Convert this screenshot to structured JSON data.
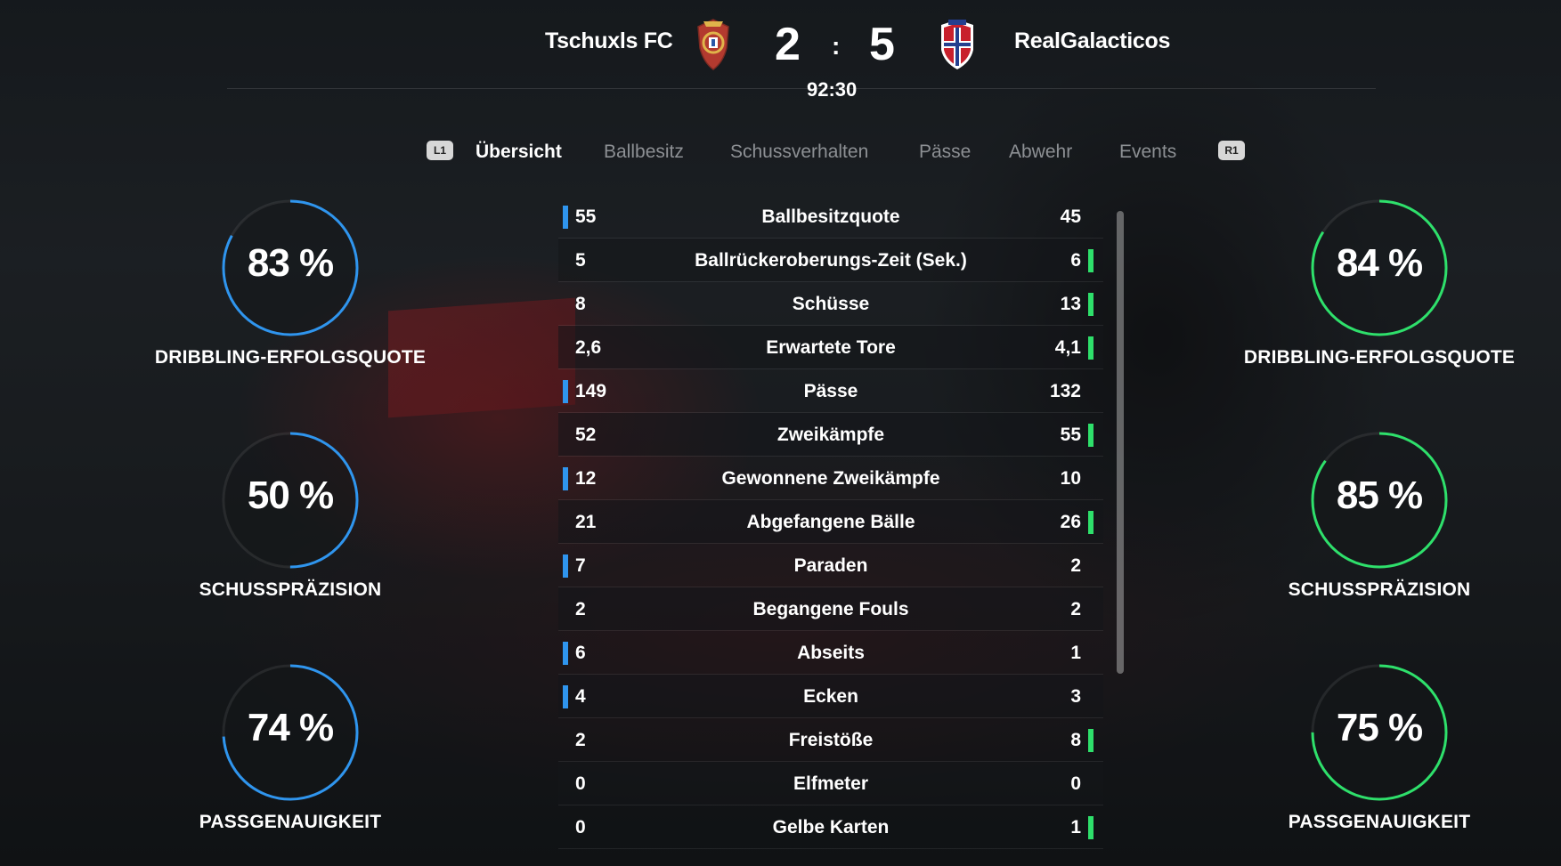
{
  "header": {
    "home_team": "Tschuxls FC",
    "away_team": "RealGalacticos",
    "home_score": "2",
    "away_score": "5",
    "separator": ":",
    "match_time": "92:30"
  },
  "tabs": {
    "left_button": "L1",
    "right_button": "R1",
    "items": [
      "Übersicht",
      "Ballbesitz",
      "Schussverhalten",
      "Pässe",
      "Abwehr",
      "Events"
    ],
    "active": "Übersicht"
  },
  "home_gauges": [
    {
      "value": "83 %",
      "fraction": 0.83,
      "label": "DRIBBLING-ERFOLGSQUOTE"
    },
    {
      "value": "50 %",
      "fraction": 0.5,
      "label": "SCHUSSPRÄZISION"
    },
    {
      "value": "74 %",
      "fraction": 0.74,
      "label": "PASSGENAUIGKEIT"
    }
  ],
  "away_gauges": [
    {
      "value": "84 %",
      "fraction": 0.84,
      "label": "DRIBBLING-ERFOLGSQUOTE"
    },
    {
      "value": "85 %",
      "fraction": 0.85,
      "label": "SCHUSSPRÄZISION"
    },
    {
      "value": "75 %",
      "fraction": 0.75,
      "label": "PASSGENAUIGKEIT"
    }
  ],
  "colors": {
    "home_accent": "#2f95ee",
    "away_accent": "#2ee06b"
  },
  "stats": [
    {
      "name": "Ballbesitzquote",
      "home": "55",
      "away": "45",
      "leader": "home"
    },
    {
      "name": "Ballrückeroberungs-Zeit (Sek.)",
      "home": "5",
      "away": "6",
      "leader": "away"
    },
    {
      "name": "Schüsse",
      "home": "8",
      "away": "13",
      "leader": "away"
    },
    {
      "name": "Erwartete Tore",
      "home": "2,6",
      "away": "4,1",
      "leader": "away"
    },
    {
      "name": "Pässe",
      "home": "149",
      "away": "132",
      "leader": "home"
    },
    {
      "name": "Zweikämpfe",
      "home": "52",
      "away": "55",
      "leader": "away"
    },
    {
      "name": "Gewonnene Zweikämpfe",
      "home": "12",
      "away": "10",
      "leader": "home"
    },
    {
      "name": "Abgefangene Bälle",
      "home": "21",
      "away": "26",
      "leader": "away"
    },
    {
      "name": "Paraden",
      "home": "7",
      "away": "2",
      "leader": "home"
    },
    {
      "name": "Begangene Fouls",
      "home": "2",
      "away": "2",
      "leader": "none"
    },
    {
      "name": "Abseits",
      "home": "6",
      "away": "1",
      "leader": "home"
    },
    {
      "name": "Ecken",
      "home": "4",
      "away": "3",
      "leader": "home"
    },
    {
      "name": "Freistöße",
      "home": "2",
      "away": "8",
      "leader": "away"
    },
    {
      "name": "Elfmeter",
      "home": "0",
      "away": "0",
      "leader": "none"
    },
    {
      "name": "Gelbe Karten",
      "home": "0",
      "away": "1",
      "leader": "away"
    }
  ]
}
